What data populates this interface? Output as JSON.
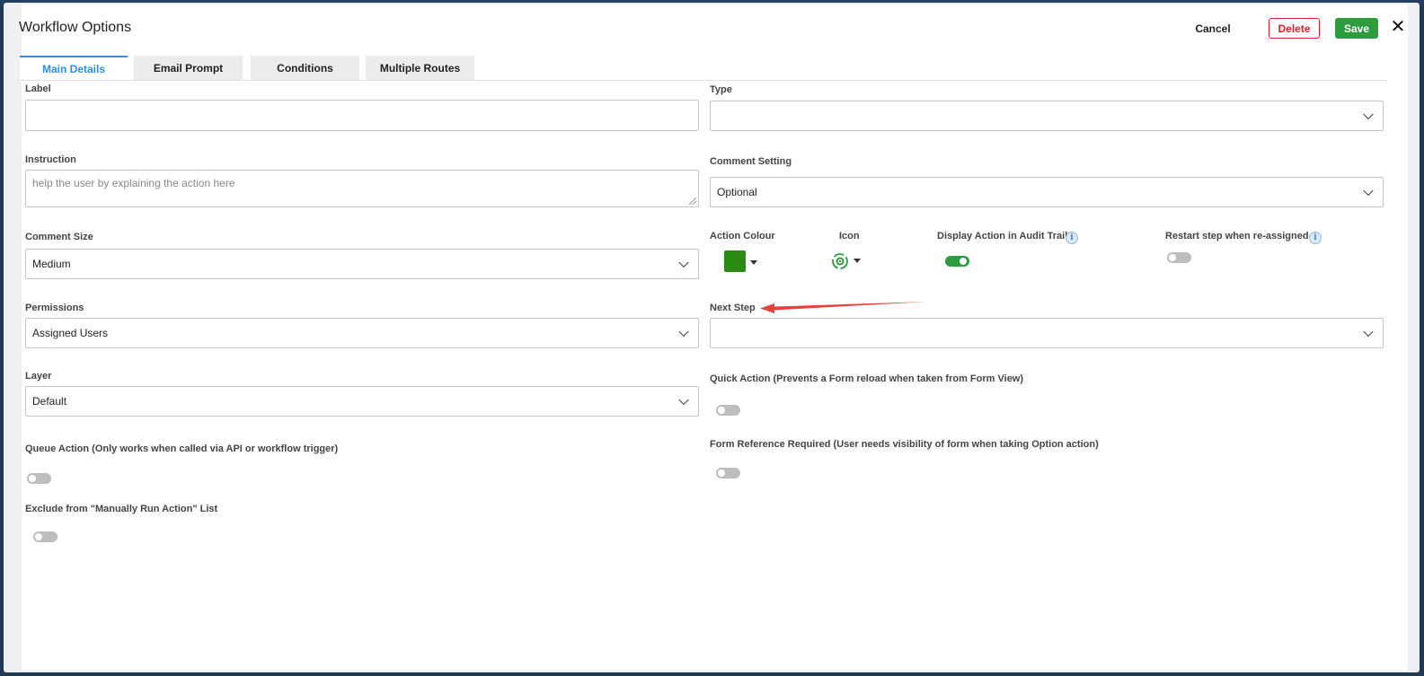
{
  "dialog": {
    "title": "Workflow Options",
    "cancel_label": "Cancel",
    "delete_label": "Delete",
    "save_label": "Save",
    "close_glyph": "✕"
  },
  "tabs": [
    {
      "label": "Main Details",
      "active": true
    },
    {
      "label": "Email Prompt",
      "active": false
    },
    {
      "label": "Conditions",
      "active": false
    },
    {
      "label": "Multiple Routes",
      "active": false
    }
  ],
  "fields": {
    "label": {
      "label": "Label",
      "value": ""
    },
    "type": {
      "label": "Type",
      "value": ""
    },
    "instruction": {
      "label": "Instruction",
      "placeholder": "help the user by explaining the action here"
    },
    "comment_setting": {
      "label": "Comment Setting",
      "value": "Optional"
    },
    "comment_size": {
      "label": "Comment Size",
      "value": "Medium"
    },
    "action_colour": {
      "label": "Action Colour",
      "color": "#2b8a11"
    },
    "icon": {
      "label": "Icon",
      "icon_name": "gear-refresh-icon",
      "color": "#2e9b3e"
    },
    "display_in_audit_trail": {
      "label": "Display Action in Audit Trail",
      "enabled": true
    },
    "restart_step": {
      "label": "Restart step when re-assigned",
      "enabled": false
    },
    "permissions": {
      "label": "Permissions",
      "value": "Assigned Users"
    },
    "next_step": {
      "label": "Next Step",
      "value": ""
    },
    "layer": {
      "label": "Layer",
      "value": "Default"
    },
    "quick_action": {
      "label": "Quick Action (Prevents a Form reload when taken from Form View)",
      "enabled": false
    },
    "queue_action": {
      "label": "Queue Action (Only works when called via API or workflow trigger)",
      "enabled": false
    },
    "form_reference_required": {
      "label": "Form Reference Required (User needs visibility of form when taking Option action)",
      "enabled": false
    },
    "exclude_manual_run": {
      "label": "Exclude from \"Manually Run Action\" List",
      "enabled": false
    }
  },
  "info_glyph": "i",
  "colors": {
    "accent": "#2d8ee6",
    "save": "#2e9b3e",
    "delete": "#d9222a",
    "annotation_arrow": "#e0443a"
  }
}
